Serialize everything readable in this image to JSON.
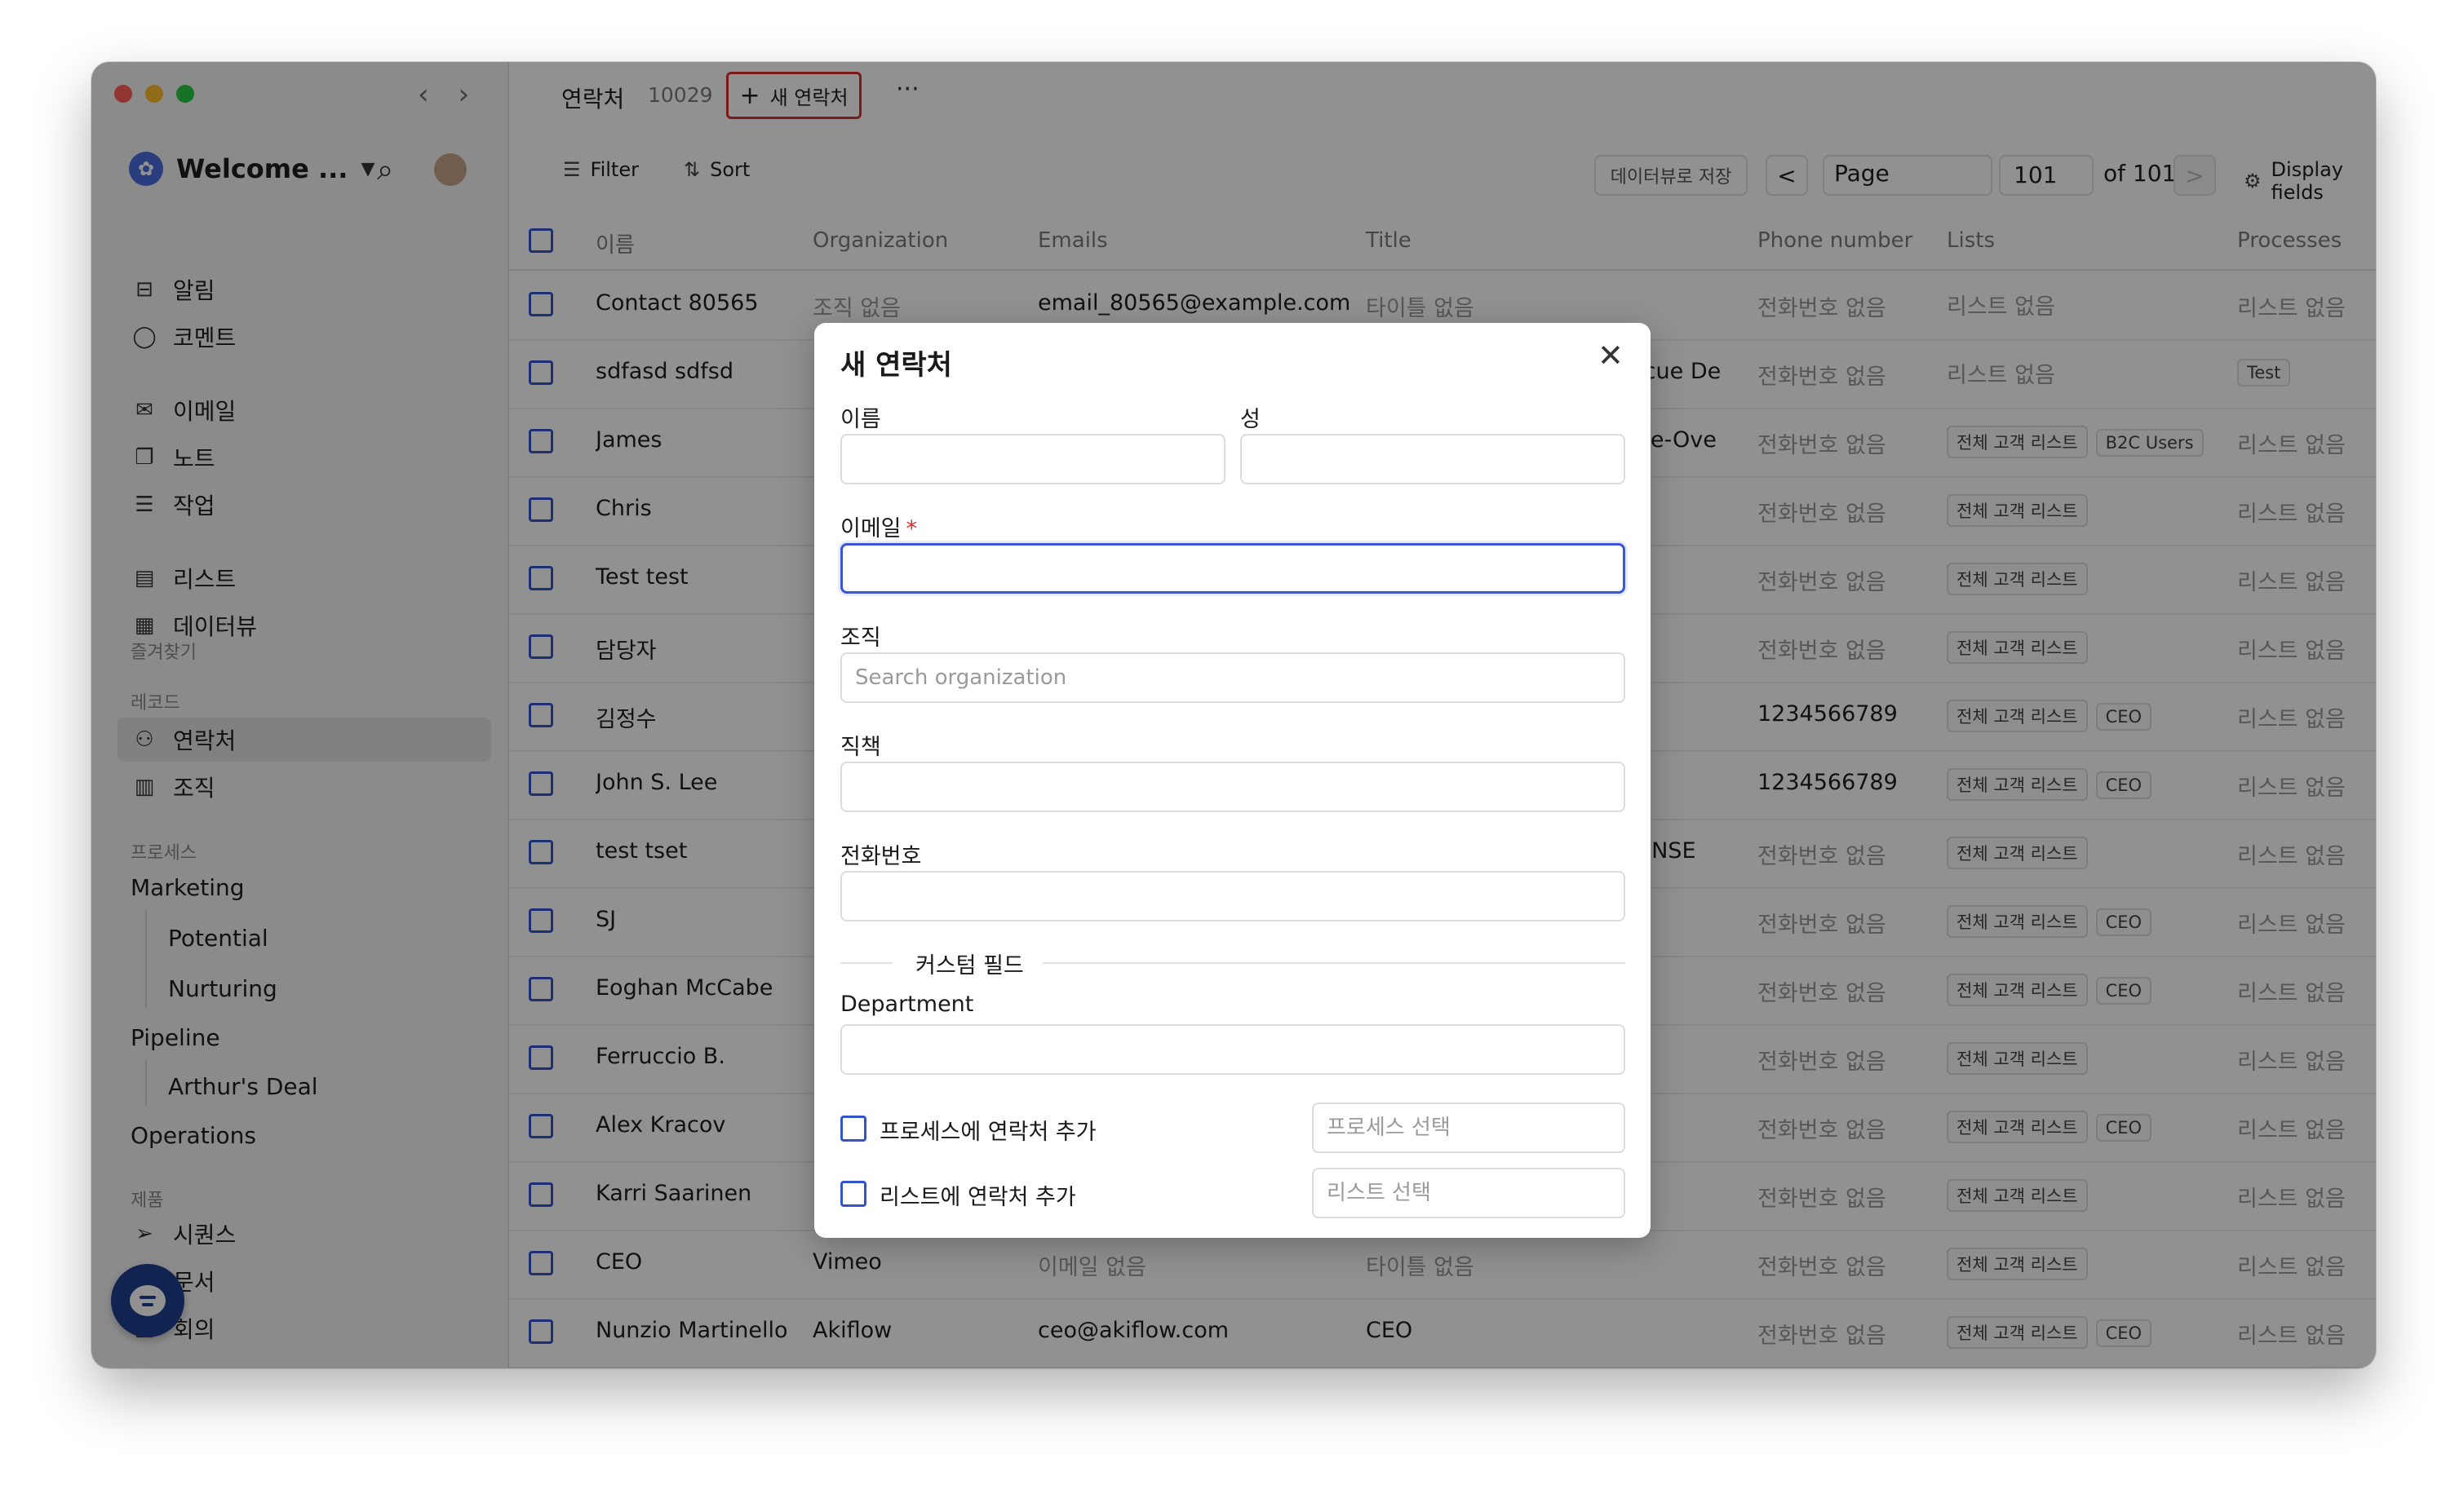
{
  "sidebar": {
    "workspace_name": "Welcome ...",
    "items_top": [
      {
        "label": "알림",
        "icon": "inbox-icon"
      },
      {
        "label": "코멘트",
        "icon": "comment-icon"
      },
      {
        "label": "이메일",
        "icon": "mail-icon"
      },
      {
        "label": "노트",
        "icon": "note-icon"
      },
      {
        "label": "작업",
        "icon": "task-icon"
      },
      {
        "label": "리스트",
        "icon": "list-icon"
      },
      {
        "label": "데이터뷰",
        "icon": "dataview-icon"
      }
    ],
    "favorites_label": "즐겨찾기",
    "records_label": "레코드",
    "records": [
      {
        "label": "연락처",
        "icon": "contacts-icon"
      },
      {
        "label": "조직",
        "icon": "organization-icon"
      }
    ],
    "process_label": "프로세스",
    "processes": [
      "Marketing",
      "Potential",
      "Nurturing",
      "Pipeline",
      "Arthur's Deal",
      "Operations"
    ],
    "products_label": "제품",
    "products": [
      {
        "label": "시퀀스",
        "icon": "send-icon"
      },
      {
        "label": "문서",
        "icon": "document-icon"
      },
      {
        "label": "회의",
        "icon": "meeting-icon"
      }
    ]
  },
  "topbar": {
    "title": "연락처",
    "count": "10029",
    "new_button": "새 연락처",
    "more": "···"
  },
  "toolbar": {
    "filter": "Filter",
    "sort": "Sort",
    "save_view": "데이터뷰로 저장",
    "prev": "<",
    "page_label": "Page",
    "page_value": "101",
    "page_of": "of 101",
    "next": ">",
    "display_fields": "Display fields"
  },
  "table": {
    "headers": [
      "이름",
      "Organization",
      "Emails",
      "Title",
      "Phone number",
      "Lists",
      "Processes"
    ],
    "rows": [
      {
        "name": "Contact 80565",
        "org": "조직 없음",
        "email": "email_80565@example.com",
        "title": "타이틀 없음",
        "phone": "전화번호 없음",
        "lists": [
          "리스트 없음"
        ],
        "process": "리스트 없음"
      },
      {
        "name": "sdfasd sdfsd",
        "org": "",
        "email": "",
        "title": "escue De",
        "phone": "전화번호 없음",
        "lists": [
          "리스트 없음"
        ],
        "process": "Test"
      },
      {
        "name": "James",
        "org": "",
        "email": "",
        "title": "oice-Ove",
        "phone": "전화번호 없음",
        "lists": [
          "전체 고객 리스트",
          "B2C Users"
        ],
        "process": "리스트 없음"
      },
      {
        "name": "Chris",
        "org": "",
        "email": "",
        "title": "",
        "phone": "전화번호 없음",
        "lists": [
          "전체 고객 리스트"
        ],
        "process": "리스트 없음"
      },
      {
        "name": "Test test",
        "org": "",
        "email": "",
        "title": "",
        "phone": "전화번호 없음",
        "lists": [
          "전체 고객 리스트"
        ],
        "process": "리스트 없음"
      },
      {
        "name": "담당자",
        "org": "",
        "email": "",
        "title": "",
        "phone": "전화번호 없음",
        "lists": [
          "전체 고객 리스트"
        ],
        "process": "리스트 없음"
      },
      {
        "name": "김정수",
        "org": "",
        "email": "",
        "title": "",
        "phone": "1234566789",
        "lists": [
          "전체 고객 리스트",
          "CEO"
        ],
        "process": "리스트 없음"
      },
      {
        "name": "John S. Lee",
        "org": "",
        "email": "",
        "title": "",
        "phone": "1234566789",
        "lists": [
          "전체 고객 리스트",
          "CEO"
        ],
        "process": "리스트 없음"
      },
      {
        "name": "test tset",
        "org": "",
        "email": "",
        "title": "CONSE",
        "phone": "전화번호 없음",
        "lists": [
          "전체 고객 리스트"
        ],
        "process": "리스트 없음"
      },
      {
        "name": "SJ",
        "org": "",
        "email": "",
        "title": "",
        "phone": "전화번호 없음",
        "lists": [
          "전체 고객 리스트",
          "CEO"
        ],
        "process": "리스트 없음"
      },
      {
        "name": "Eoghan McCabe",
        "org": "",
        "email": "",
        "title": "",
        "phone": "전화번호 없음",
        "lists": [
          "전체 고객 리스트",
          "CEO"
        ],
        "process": "리스트 없음"
      },
      {
        "name": "Ferruccio B.",
        "org": "",
        "email": "",
        "title": "",
        "phone": "전화번호 없음",
        "lists": [
          "전체 고객 리스트"
        ],
        "process": "리스트 없음"
      },
      {
        "name": "Alex Kracov",
        "org": "",
        "email": "",
        "title": "",
        "phone": "전화번호 없음",
        "lists": [
          "전체 고객 리스트",
          "CEO"
        ],
        "process": "리스트 없음"
      },
      {
        "name": "Karri Saarinen",
        "org": "",
        "email": "",
        "title": "",
        "phone": "전화번호 없음",
        "lists": [
          "전체 고객 리스트"
        ],
        "process": "리스트 없음"
      },
      {
        "name": "CEO",
        "org": "Vimeo",
        "email": "이메일 없음",
        "title": "타이틀 없음",
        "phone": "전화번호 없음",
        "lists": [
          "전체 고객 리스트"
        ],
        "process": "리스트 없음"
      },
      {
        "name": "Nunzio Martinello",
        "org": "Akiflow",
        "email": "ceo@akiflow.com",
        "title": "CEO",
        "phone": "전화번호 없음",
        "lists": [
          "전체 고객 리스트",
          "CEO"
        ],
        "process": "리스트 없음"
      }
    ]
  },
  "modal": {
    "title": "새 연락처",
    "close": "✕",
    "first_name_label": "이름",
    "last_name_label": "성",
    "email_label": "이메일",
    "email_required": "*",
    "org_label": "조직",
    "org_placeholder": "Search organization",
    "job_label": "직책",
    "phone_label": "전화번호",
    "custom_fields_label": "커스텀 필드",
    "department_label": "Department",
    "add_to_process_label": "프로세스에 연락처 추가",
    "process_placeholder": "프로세스 선택",
    "add_to_list_label": "리스트에 연락처 추가",
    "list_placeholder": "리스트 선택"
  },
  "colors": {
    "accent": "#3a55d8",
    "highlight_border": "#d9302c",
    "chat_button": "#1e3f8f"
  }
}
